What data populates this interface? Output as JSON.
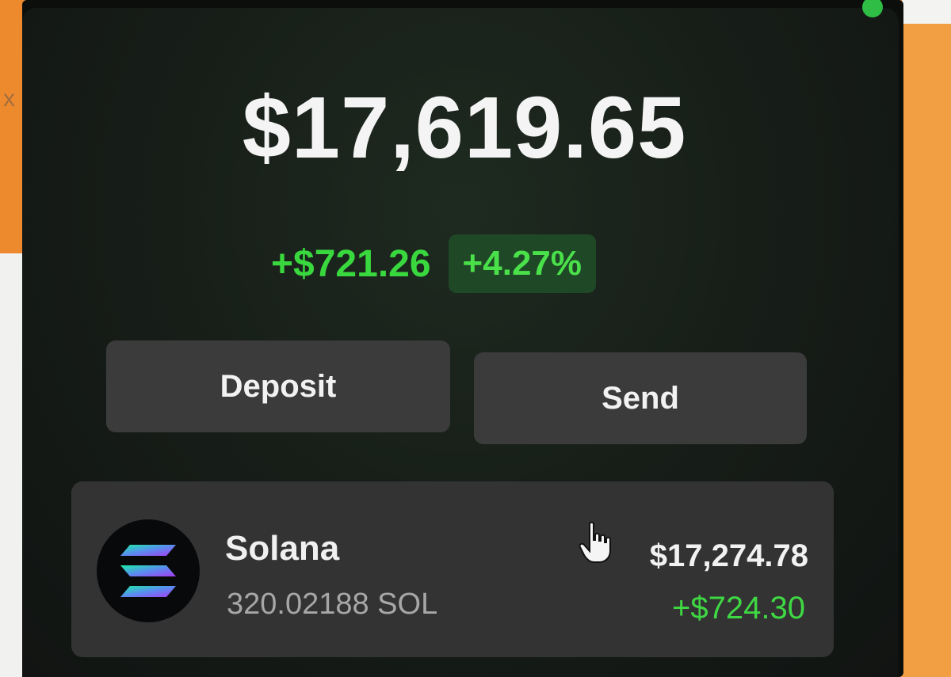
{
  "wallet": {
    "balance": "$17,619.65",
    "change_amount": "+$721.26",
    "change_percent": "+4.27%"
  },
  "actions": {
    "deposit_label": "Deposit",
    "send_label": "Send"
  },
  "tokens": [
    {
      "name": "Solana",
      "quantity": "320.02188 SOL",
      "value": "$17,274.78",
      "change": "+$724.30",
      "icon": "solana-logo"
    }
  ],
  "colors": {
    "positive": "#39d83e",
    "positive_pill_bg": "#1f4826",
    "panel_bg": "#161c17",
    "button_bg": "#3b3b3c",
    "row_bg": "#333334"
  }
}
